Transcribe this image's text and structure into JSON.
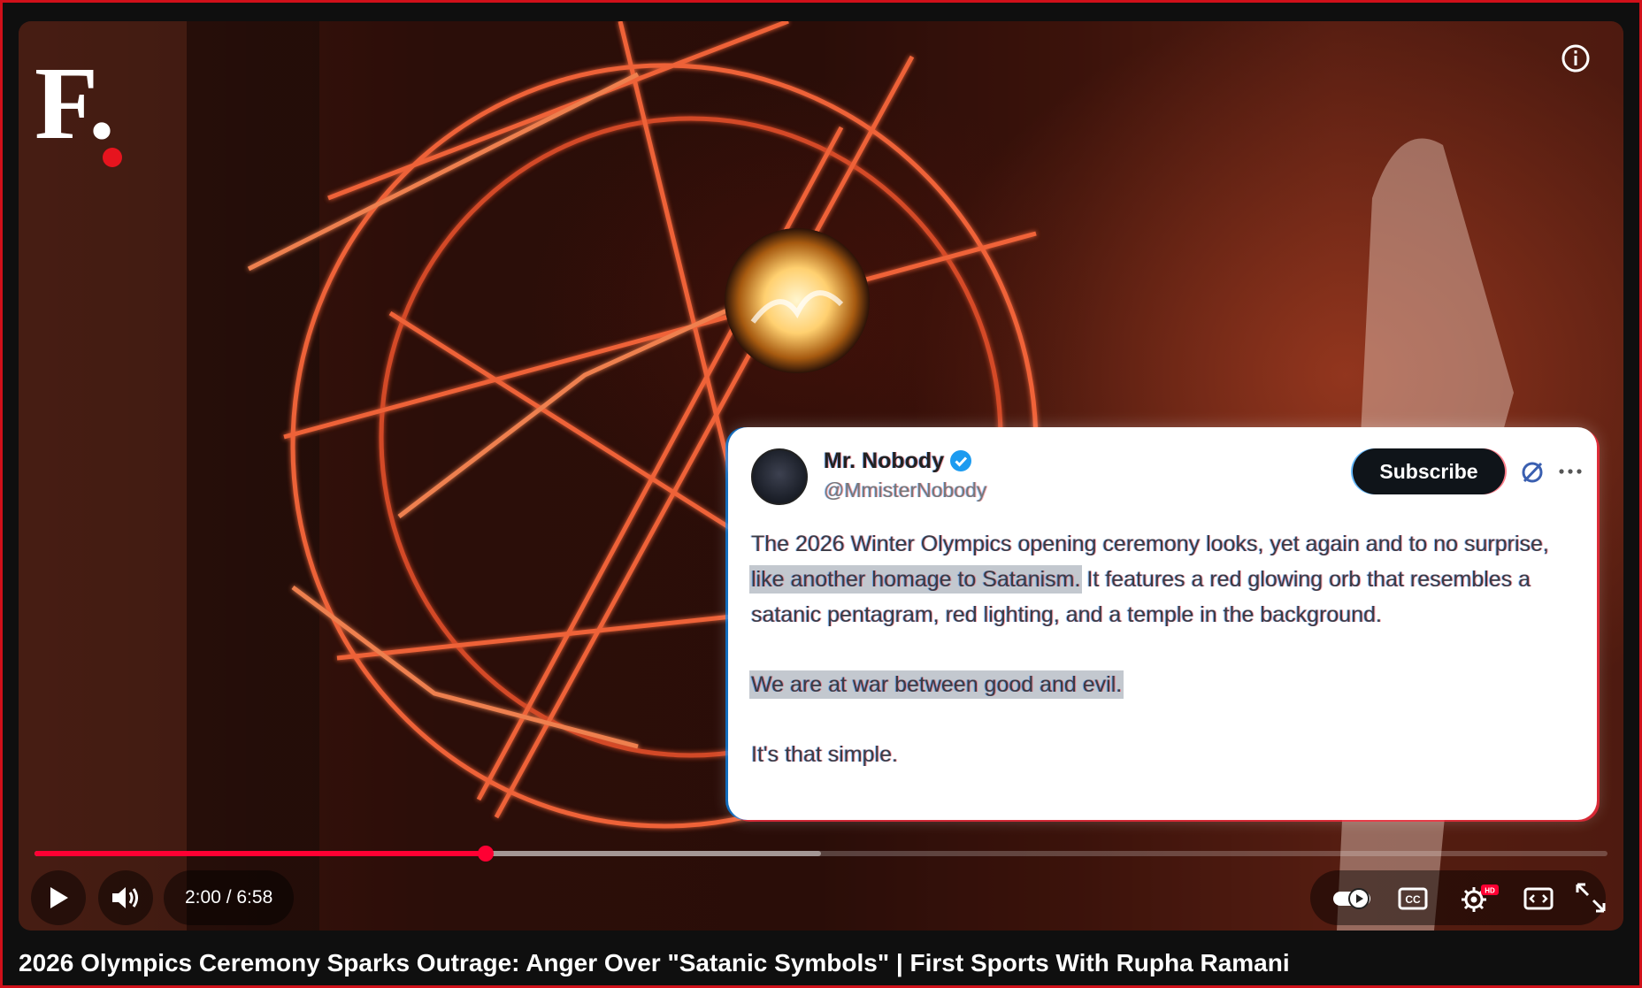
{
  "player": {
    "logo_text": "F.",
    "tweet": {
      "author_name": "Mr. Nobody",
      "handle": "@MmisterNobody",
      "subscribe_label": "Subscribe",
      "paragraph1_a": "The 2026 Winter Olympics opening ceremony looks, yet again and to no surprise, ",
      "paragraph1_highlight": "like another homage to Satanism.",
      "paragraph1_b": " It features a red glowing orb that resembles a satanic pentagram, red lighting, and a temple in the background.",
      "paragraph2": "We are at war between good and evil.",
      "paragraph3": "It's that simple."
    },
    "controls": {
      "time_display": "2:00 / 6:58",
      "progress_fraction": 0.2866,
      "buffered_fraction": 0.5,
      "hd_badge": "HD",
      "icons": [
        "play-icon",
        "volume-icon",
        "autoplay-toggle-icon",
        "captions-icon",
        "settings-icon",
        "miniplayer-icon",
        "fullscreen-icon",
        "info-icon",
        "verified-icon",
        "grok-icon",
        "more-icon"
      ]
    }
  },
  "video_title": "2026 Olympics Ceremony Sparks Outrage: Anger Over \"Satanic Symbols\" | First Sports With Rupha Ramani",
  "colors": {
    "progress": "#ff0033",
    "frame": "#d0101a",
    "logo_dot": "#e6141e"
  }
}
